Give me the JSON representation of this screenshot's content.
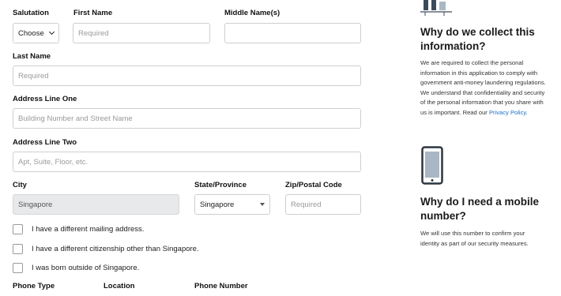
{
  "form": {
    "salutation": {
      "label": "Salutation",
      "value": "Choose"
    },
    "first_name": {
      "label": "First Name",
      "placeholder": "Required"
    },
    "middle_name": {
      "label": "Middle Name(s)",
      "placeholder": ""
    },
    "last_name": {
      "label": "Last Name",
      "placeholder": "Required"
    },
    "address_one": {
      "label": "Address Line One",
      "placeholder": "Building Number and Street Name"
    },
    "address_two": {
      "label": "Address Line Two",
      "placeholder": "Apt, Suite, Floor, etc."
    },
    "city": {
      "label": "City",
      "value": "Singapore"
    },
    "state": {
      "label": "State/Province",
      "value": "Singapore"
    },
    "zip": {
      "label": "Zip/Postal Code",
      "placeholder": "Required"
    },
    "checkboxes": [
      {
        "label": "I have a different mailing address.",
        "checked": false
      },
      {
        "label": "I have a different citizenship other than Singapore.",
        "checked": false
      },
      {
        "label": "I was born outside of Singapore.",
        "checked": false
      }
    ],
    "phone_type_label": "Phone Type",
    "location_label": "Location",
    "phone_number_label": "Phone Number"
  },
  "sidebar": {
    "collect": {
      "icon": "people-illustration-icon",
      "heading": "Why do we collect this information?",
      "body": "We are required to collect the personal information in this application to comply with government anti-money laundering regulations. We understand that confidentiality and security of the personal information that you share with us is important. Read our ",
      "link": "Privacy Policy",
      "suffix": "."
    },
    "mobile": {
      "icon": "mobile-phone-icon",
      "heading": "Why do I need a mobile number?",
      "body": "We will use this number to confirm your identity as part of our security measures."
    }
  },
  "colors": {
    "link": "#1a6fd1",
    "disabled_bg": "#e8e9ea",
    "text": "#1a1a1a"
  }
}
